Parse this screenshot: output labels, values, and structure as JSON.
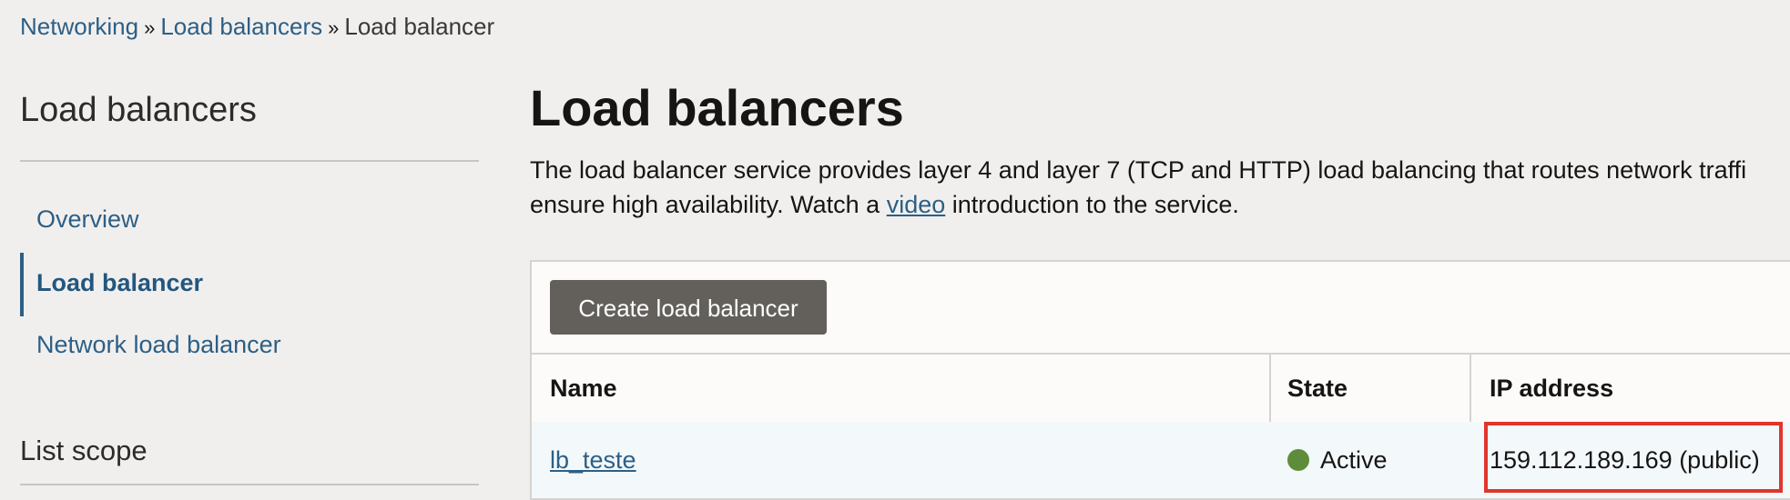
{
  "breadcrumb": {
    "items": [
      "Networking",
      "Load balancers"
    ],
    "separator": "»",
    "current": "Load balancer"
  },
  "sidebar": {
    "title": "Load balancers",
    "items": [
      {
        "label": "Overview",
        "active": false
      },
      {
        "label": "Load balancer",
        "active": true
      },
      {
        "label": "Network load balancer",
        "active": false
      }
    ],
    "list_scope_label": "List scope"
  },
  "main": {
    "title": "Load balancers",
    "description_line1": "The load balancer service provides layer 4 and layer 7 (TCP and HTTP) load balancing that routes network traffi",
    "description_line2_prefix": "ensure high availability. Watch a ",
    "description_link": "video",
    "description_line2_suffix": " introduction to the service."
  },
  "toolbar": {
    "create_label": "Create load balancer"
  },
  "table": {
    "headers": {
      "name": "Name",
      "state": "State",
      "ip": "IP address"
    },
    "rows": [
      {
        "name": "lb_teste",
        "state": "Active",
        "ip": "159.112.189.169 (public)"
      }
    ]
  },
  "colors": {
    "accent": "#2c5f86",
    "active_status": "#5f8c3a",
    "highlight": "#e1352b"
  }
}
